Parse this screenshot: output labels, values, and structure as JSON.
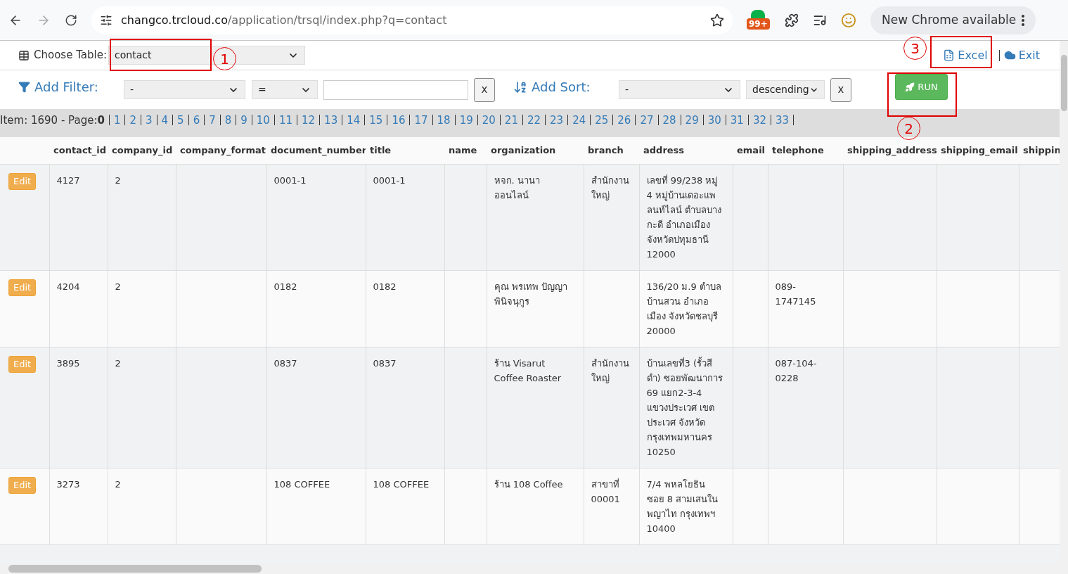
{
  "browser": {
    "url_host": "changco.trcloud.co",
    "url_path": "/application/trsql/index.php?q=contact",
    "badge": "99+",
    "update_button": "New Chrome available"
  },
  "toolbar": {
    "choose_label": "Choose Table:",
    "table_value": "contact",
    "excel": "Excel",
    "exit": "Exit"
  },
  "filter": {
    "label": "Add Filter:",
    "field": "-",
    "operator": "=",
    "clear": "x"
  },
  "sort": {
    "label": "Add Sort:",
    "field": "-",
    "direction": "descending",
    "clear": "x"
  },
  "run_button": "RUN",
  "pagination": {
    "summary": "Item: 1690 - Page:",
    "current": "0",
    "pages": [
      "1",
      "2",
      "3",
      "4",
      "5",
      "6",
      "7",
      "8",
      "9",
      "10",
      "11",
      "12",
      "13",
      "14",
      "15",
      "16",
      "17",
      "18",
      "19",
      "20",
      "21",
      "22",
      "23",
      "24",
      "25",
      "26",
      "27",
      "28",
      "29",
      "30",
      "31",
      "32",
      "33"
    ]
  },
  "table": {
    "columns": [
      "contact_id",
      "company_id",
      "company_format",
      "document_number",
      "title",
      "name",
      "organization",
      "branch",
      "address",
      "email",
      "telephone",
      "shipping_address",
      "shipping_email",
      "shippin"
    ],
    "rows": [
      {
        "edit": "Edit",
        "cells": [
          "4127",
          "2",
          "",
          "0001-1",
          "0001-1",
          "",
          "หจก. นานา ออนไลน์",
          "สำนักงานใหญ่",
          "เลขที่ 99/238 หมู่ 4 หมู่บ้านเดอะแพลนท์ไลน์ ตำบลบางกะดี อำเภอเมือง จังหวัดปทุมธานี 12000",
          "",
          "",
          "",
          "",
          ""
        ]
      },
      {
        "edit": "Edit",
        "cells": [
          "4204",
          "2",
          "",
          "0182",
          "0182",
          "",
          "คุณ พรเทพ ปัญญาพินิจนุกูร",
          "",
          "136/20 ม.9 ตำบลบ้านสวน อำเภอเมือง จังหวัดชลบุรี 20000",
          "",
          "089-1747145",
          "",
          "",
          ""
        ]
      },
      {
        "edit": "Edit",
        "cells": [
          "3895",
          "2",
          "",
          "0837",
          "0837",
          "",
          "ร้าน Visarut Coffee Roaster",
          "สำนักงานใหญ่",
          "บ้านเลขที่3 (รั้วสีดำ) ซอยพัฒนาการ 69 แยก2-3-4 แขวงประเวศ เขตประเวศ จังหวัดกรุงเทพมหานคร 10250",
          "",
          "087-104-0228",
          "",
          "",
          ""
        ]
      },
      {
        "edit": "Edit",
        "cells": [
          "3273",
          "2",
          "",
          "108 COFFEE",
          "108 COFFEE",
          "",
          "ร้าน 108 Coffee",
          "สาขาที่ 00001",
          "7/4 พหลโยธิน ซอย 8 สามเสนใน พญาไท กรุงเทพฯ 10400",
          "",
          "",
          "",
          "",
          ""
        ]
      }
    ]
  },
  "annotations": [
    {
      "number": "1"
    },
    {
      "number": "2"
    },
    {
      "number": "3"
    }
  ]
}
